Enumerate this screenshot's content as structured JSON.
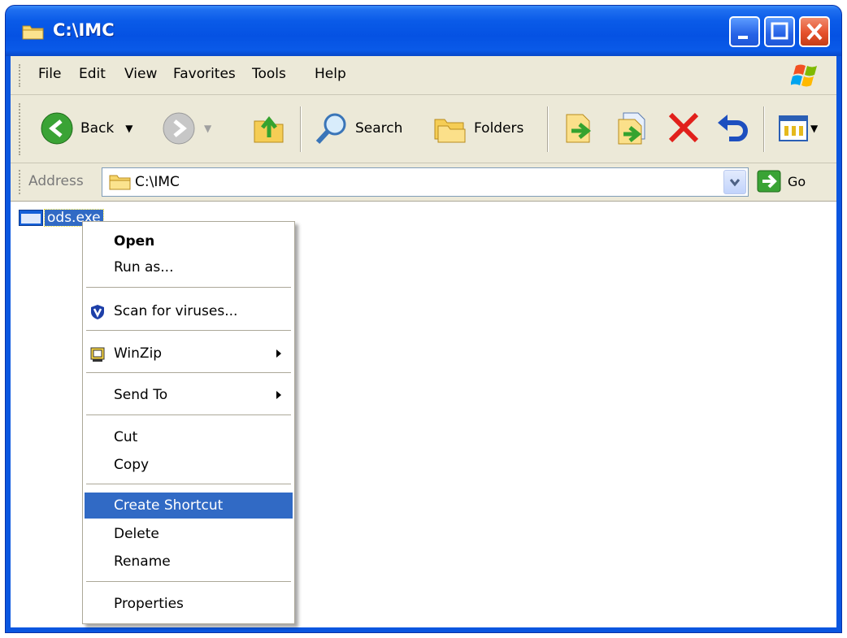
{
  "window": {
    "title": "C:\\IMC",
    "accent": "#0a56e0"
  },
  "menubar": {
    "items": [
      "File",
      "Edit",
      "View",
      "Favorites",
      "Tools",
      "Help"
    ]
  },
  "toolbar": {
    "back_label": "Back",
    "search_label": "Search",
    "folders_label": "Folders"
  },
  "address": {
    "label": "Address",
    "value": "C:\\IMC",
    "go_label": "Go"
  },
  "files": [
    {
      "name": "ods.exe",
      "selected": true
    }
  ],
  "context_menu": {
    "items": [
      {
        "label": "Open",
        "bold": true
      },
      {
        "label": "Run as..."
      },
      {
        "label": "Scan for viruses...",
        "icon": "shield-icon"
      },
      {
        "label": "WinZip",
        "icon": "winzip-icon",
        "submenu": true
      },
      {
        "label": "Send To",
        "submenu": true
      },
      {
        "label": "Cut"
      },
      {
        "label": "Copy"
      },
      {
        "label": "Create Shortcut",
        "highlighted": true
      },
      {
        "label": "Delete"
      },
      {
        "label": "Rename"
      },
      {
        "label": "Properties"
      }
    ]
  }
}
